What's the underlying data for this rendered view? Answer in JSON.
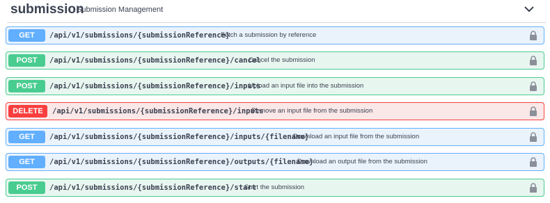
{
  "section": {
    "title": "submission",
    "description": "Submission Management",
    "expand_icon": "chevron-down-icon"
  },
  "operations": [
    {
      "method": "GET",
      "path": "/api/v1/submissions/{submissionReference}",
      "summary": "Fetch a submission by reference",
      "lock_icon": "lock-icon"
    },
    {
      "method": "POST",
      "path": "/api/v1/submissions/{submissionReference}/cancel",
      "summary": "Cancel the submission",
      "lock_icon": "lock-icon"
    },
    {
      "method": "POST",
      "path": "/api/v1/submissions/{submissionReference}/inputs",
      "summary": "Upload an input file into the submission",
      "lock_icon": "lock-icon"
    },
    {
      "method": "DELETE",
      "path": "/api/v1/submissions/{submissionReference}/inputs",
      "summary": "Remove an input file from the submission",
      "lock_icon": "lock-icon"
    },
    {
      "method": "GET",
      "path": "/api/v1/submissions/{submissionReference}/inputs/{filename}",
      "summary": "Download an input file from the submission",
      "lock_icon": "lock-icon"
    },
    {
      "method": "GET",
      "path": "/api/v1/submissions/{submissionReference}/outputs/{filename}",
      "summary": "Download an output file from the submission",
      "lock_icon": "lock-icon"
    },
    {
      "method": "POST",
      "path": "/api/v1/submissions/{submissionReference}/start",
      "summary": "Start the submission",
      "lock_icon": "lock-icon"
    }
  ],
  "colors": {
    "get": "#61affe",
    "post": "#49cc90",
    "delete": "#f93e3e",
    "text": "#3b4151"
  }
}
